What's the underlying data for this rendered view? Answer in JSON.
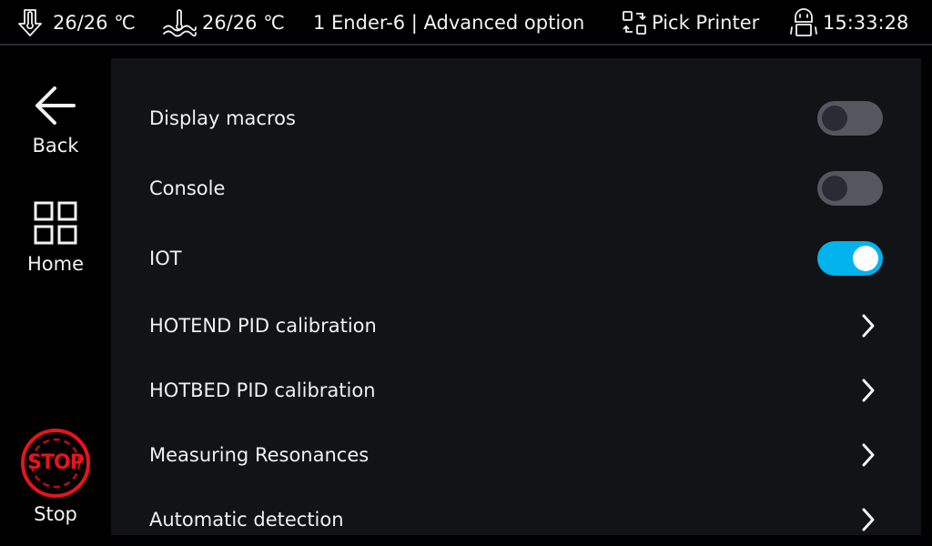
{
  "topbar": {
    "extruder_temp": "26/26 ℃",
    "bed_temp": "26/26 ℃",
    "title": "1 Ender-6 | Advanced option",
    "pick_printer_label": "Pick Printer",
    "time": "15:33:28"
  },
  "sidebar": {
    "back_label": "Back",
    "home_label": "Home",
    "stop_label": "Stop",
    "stop_icon_text": "STOP"
  },
  "settings": {
    "items": [
      {
        "label": "Display macros",
        "type": "toggle",
        "on": false
      },
      {
        "label": "Console",
        "type": "toggle",
        "on": false
      },
      {
        "label": "IOT",
        "type": "toggle",
        "on": true
      },
      {
        "label": "HOTEND PID calibration",
        "type": "link"
      },
      {
        "label": "HOTBED PID calibration",
        "type": "link"
      },
      {
        "label": "Measuring Resonances",
        "type": "link"
      },
      {
        "label": "Automatic detection",
        "type": "link"
      }
    ]
  },
  "colors": {
    "accent": "#00b3ec",
    "stop_red": "#e8141c",
    "panel_bg": "#121317",
    "toggle_off": "#55565e"
  }
}
